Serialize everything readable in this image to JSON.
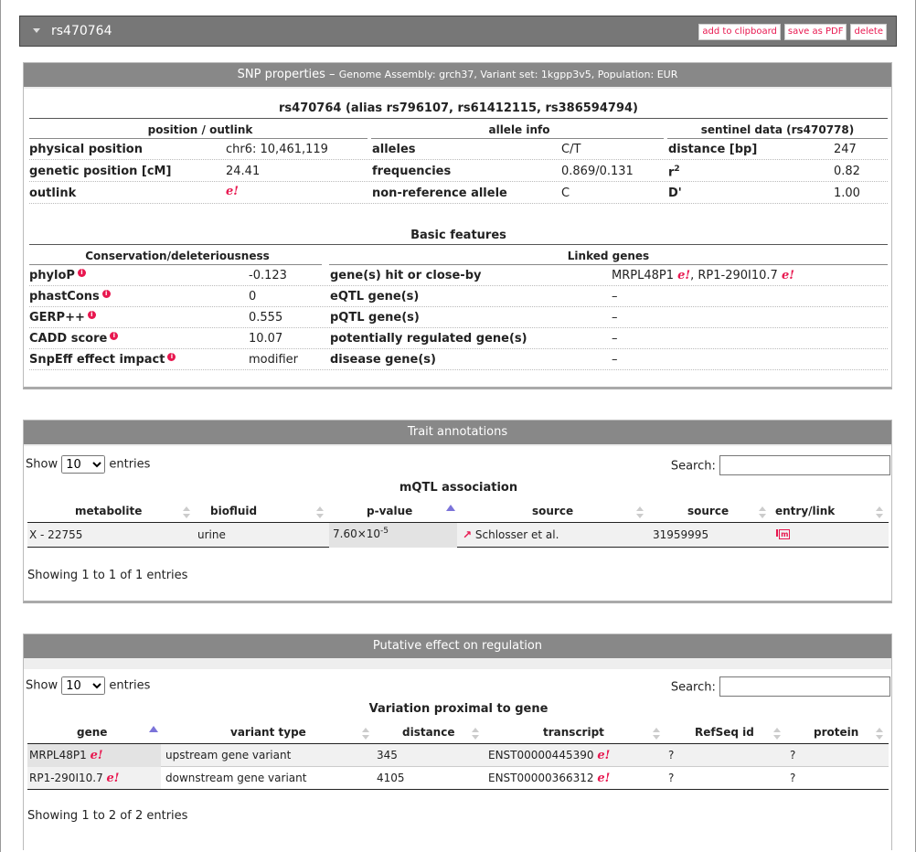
{
  "header": {
    "title": "rs470764",
    "buttons": [
      "add to clipboard",
      "save as PDF",
      "delete"
    ]
  },
  "snp": {
    "panel_title": "SNP properties – ",
    "panel_subtitle": "Genome Assembly: grch37, Variant set: 1kgpp3v5, Population: EUR",
    "heading": "rs470764 (alias rs796107, rs61412115, rs386594794)",
    "col_headers": [
      "position / outlink",
      "allele info",
      "sentinel data (rs470778)"
    ],
    "rows": [
      [
        "physical position",
        "chr6: 10,461,119",
        "alleles",
        "C/T",
        "distance [bp]",
        "247"
      ],
      [
        "genetic position [cM]",
        "24.41",
        "frequencies",
        "0.869/0.131",
        "r",
        "0.82"
      ],
      [
        "outlink",
        "e!",
        "non-reference allele",
        "C",
        "D'",
        "1.00"
      ]
    ],
    "r_sup": "2",
    "basic_title": "Basic features",
    "basic_headers": [
      "Conservation/deleteriousness",
      "Linked genes"
    ],
    "basic_rows": [
      [
        "phyloP",
        "-0.123",
        "gene(s) hit or close-by",
        "MRPL48P1",
        "RP1-290I10.7"
      ],
      [
        "phastCons",
        "0",
        "eQTL gene(s)",
        "–"
      ],
      [
        "GERP++",
        "0.555",
        "pQTL gene(s)",
        "–"
      ],
      [
        "CADD score",
        "10.07",
        "potentially regulated gene(s)",
        "–"
      ],
      [
        "SnpEff effect impact",
        "modifier",
        "disease gene(s)",
        "–"
      ]
    ]
  },
  "trait": {
    "panel_title": "Trait annotations",
    "show": "Show",
    "entries": "entries",
    "length": "10",
    "search": "Search:",
    "table_title": "mQTL association",
    "columns": [
      "metabolite",
      "biofluid",
      "p-value",
      "source",
      "source",
      "entry/link"
    ],
    "rows": [
      {
        "metabolite": "X - 22755",
        "biofluid": "urine",
        "p_base": "7.60×10",
        "p_exp": "-5",
        "source": "Schlosser et al.",
        "pmid": "31959995"
      }
    ],
    "info": "Showing 1 to 1 of 1 entries"
  },
  "reg": {
    "panel_title": "Putative effect on regulation",
    "show": "Show",
    "entries": "entries",
    "length": "10",
    "search": "Search:",
    "table_title": "Variation proximal to gene",
    "columns": [
      "gene",
      "variant type",
      "distance",
      "transcript",
      "RefSeq id",
      "protein"
    ],
    "rows": [
      {
        "gene": "MRPL48P1",
        "type": "upstream gene variant",
        "distance": "345",
        "transcript": "ENST00000445390",
        "refseq": "?",
        "protein": "?"
      },
      {
        "gene": "RP1-290I10.7",
        "type": "downstream gene variant",
        "distance": "4105",
        "transcript": "ENST00000366312",
        "refseq": "?",
        "protein": "?"
      }
    ],
    "info": "Showing 1 to 2 of 2 entries"
  },
  "colors": {
    "accent": "#e8174f",
    "header_bg": "#777777",
    "panel_title_bg": "#888888",
    "sort_active": "#7b73d9"
  }
}
